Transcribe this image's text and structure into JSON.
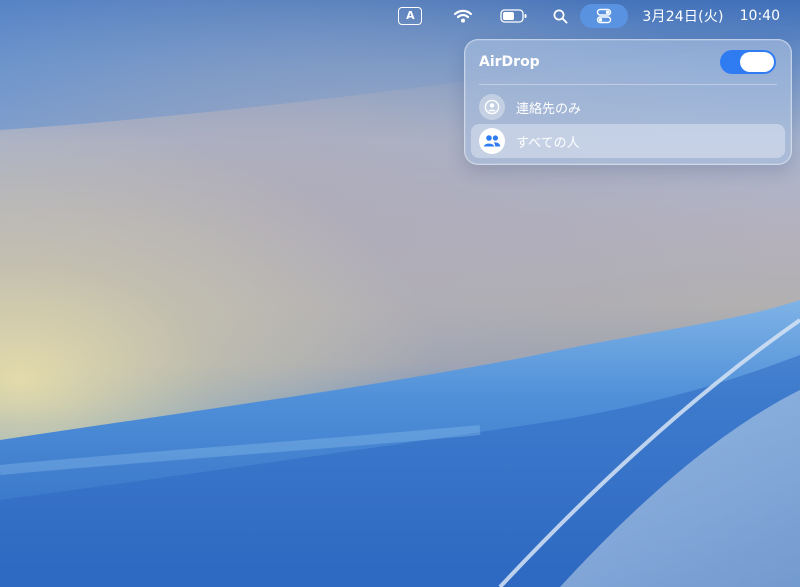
{
  "menubar": {
    "input_source": "A",
    "date": "3月24日(火)",
    "time": "10:40"
  },
  "airdrop_panel": {
    "title": "AirDrop",
    "enabled": true,
    "options": [
      {
        "label": "連絡先のみ",
        "selected": false
      },
      {
        "label": "すべての人",
        "selected": true
      }
    ]
  },
  "colors": {
    "toggle_on": "#2f7cf2",
    "control_center_active": "#5a96e6"
  },
  "icons": {
    "input_source": "input-source-icon",
    "wifi": "wifi-icon",
    "battery": "battery-icon",
    "search": "spotlight-search-icon",
    "control_center": "control-center-icon",
    "contacts_only": "person-circle-icon",
    "everyone": "people-icon"
  }
}
